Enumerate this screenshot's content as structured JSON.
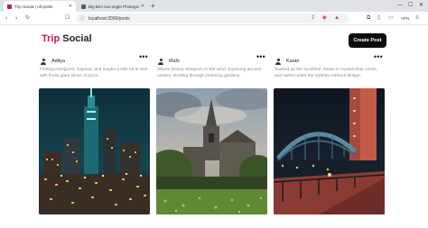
{
  "browser": {
    "tabs": [
      {
        "title": "Trip Social | All posts",
        "favicon_color": "#c2185b"
      },
      {
        "title": "Big Ben low angle Photography",
        "favicon_color": "#5a5a5a"
      }
    ],
    "address": "localhost:3000/posts",
    "vpn_label": "VPN"
  },
  "header": {
    "logo_part1": "Trip",
    "logo_part2": "Social",
    "create_button": "Create Post",
    "brand_color": "#c2185b"
  },
  "posts": [
    {
      "author": "Aditya",
      "caption": "Feeling energized, inspired, and maybe a little bit in love with those giant slices of pizza.",
      "photo": "night-city-skyline"
    },
    {
      "author": "Mahi",
      "caption": "Where history whispers on the wind. Exploring ancient castles, strolling through charming gardens.",
      "photo": "gothic-church-garden"
    },
    {
      "author": "Karan",
      "caption": "Soaked up the sunshine, swam in crystal-clear coves, and sailed under the Sydney Harbour Bridge.",
      "photo": "sydney-harbour-bridge-night"
    }
  ]
}
